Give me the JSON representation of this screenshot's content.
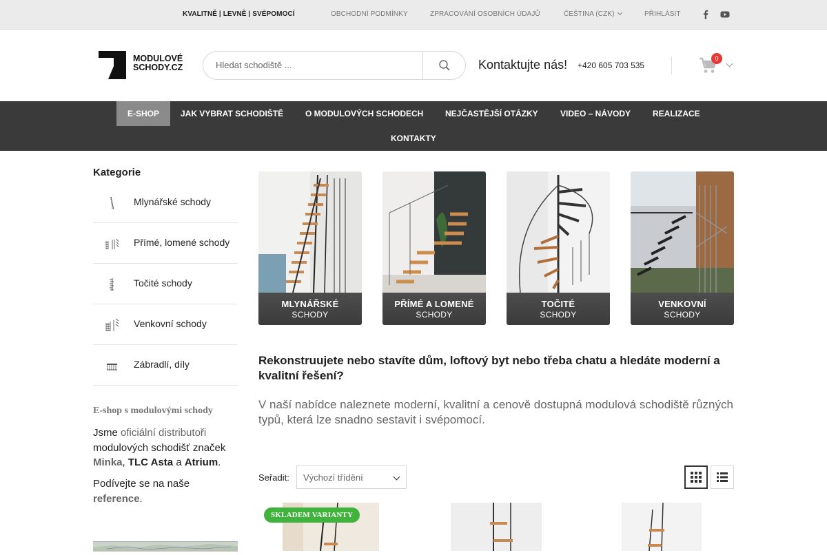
{
  "topbar": {
    "slogan": "KVALITNĚ | LEVNĚ | SVÉPOMOCÍ",
    "links": [
      "OBCHODNÍ PODMÍNKY",
      "ZPRACOVÁNÍ OSOBNÍCH ÚDAJŮ"
    ],
    "language": "ČEŠTINA (CZK)",
    "login": "PŘIHLÁSIT",
    "social_icons": [
      "facebook-icon",
      "youtube-icon"
    ]
  },
  "header": {
    "logo_text_line1": "MODULOVÉ",
    "logo_text_line2": "SCHODY.CZ",
    "search_placeholder": "Hledat schodiště ...",
    "contact_title": "Kontaktujte nás!",
    "phone": "+420 605 703 535",
    "cart_count": "0"
  },
  "nav": {
    "items": [
      "E-SHOP",
      "JAK VYBRAT SCHODIŠTĚ",
      "O MODULOVÝCH SCHODECH",
      "NEJČASTĚJŠÍ OTÁZKY",
      "VIDEO – NÁVODY",
      "REALIZACE",
      "KONTAKTY"
    ],
    "active": "E-SHOP"
  },
  "sidebar": {
    "title": "Kategorie",
    "categories": [
      "Mlynářské schody",
      "Přímé, lomené schody",
      "Točité schody",
      "Venkovní schody",
      "Zábradlí, díly"
    ],
    "eshop_title": "E-shop s modulovými schody",
    "text1_a": "Jsme",
    "text1_b": "oficiální distributoři",
    "text1_c": "modulových schodišť značek",
    "brand1": "Minka",
    "brand2": "TLC Asta",
    "and": "a",
    "brand3": "Atrium",
    "text2_a": "Podívejte se na naše",
    "text2_b": "reference"
  },
  "banners": [
    {
      "line1": "MLYNÁŘSKÉ",
      "line2": "SCHODY"
    },
    {
      "line1": "PŘÍMÉ A LOMENÉ",
      "line2": "SCHODY"
    },
    {
      "line1": "TOČITÉ",
      "line2": "SCHODY"
    },
    {
      "line1": "VENKOVNÍ",
      "line2": "SCHODY"
    }
  ],
  "intro": {
    "heading": "Rekonstruujete nebo stavíte dům, loftový byt nebo třeba chatu a hledáte moderní a kvalitní řešení?",
    "text": "V naší nabídce naleznete moderní, kvalitní a cenově dostupná modulová schodiště různých typů, která lze snadno sestavit i svépomocí."
  },
  "sorting": {
    "label": "Seřadit:",
    "selected": "Výchozí třídění",
    "view_modes": [
      "grid-icon",
      "list-icon"
    ]
  },
  "products": {
    "badge": "SKLADEM VARIANTY"
  },
  "colors": {
    "nav_bg": "#3a3a3a",
    "nav_active": "#8a8a8a",
    "badge_green": "#3fb33c",
    "cart_badge": "#e53935"
  }
}
